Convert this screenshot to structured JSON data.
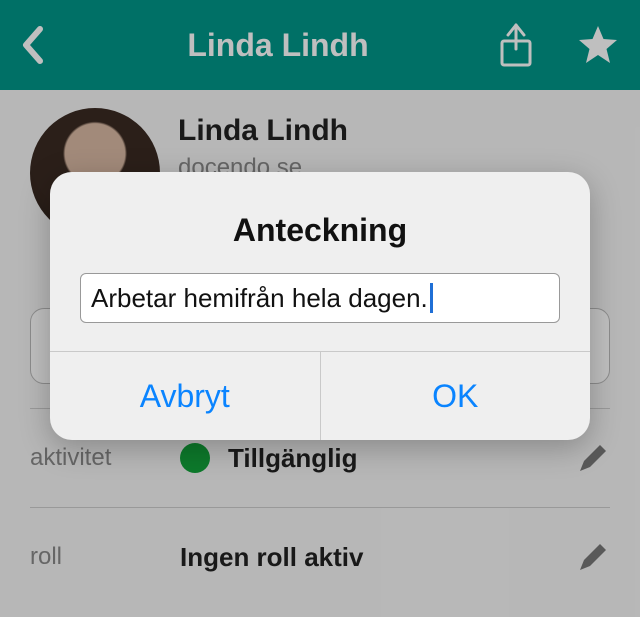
{
  "header": {
    "title": "Linda Lindh"
  },
  "profile": {
    "name": "Linda Lindh",
    "subtitle": "docendo.se"
  },
  "rows": {
    "activity": {
      "label": "aktivitet",
      "value": "Tillgänglig",
      "status_color": "#12a23a"
    },
    "role": {
      "label": "roll",
      "value": "Ingen roll aktiv"
    }
  },
  "dialog": {
    "title": "Anteckning",
    "input_value": "Arbetar hemifrån hela dagen.",
    "cancel": "Avbryt",
    "ok": "OK"
  }
}
